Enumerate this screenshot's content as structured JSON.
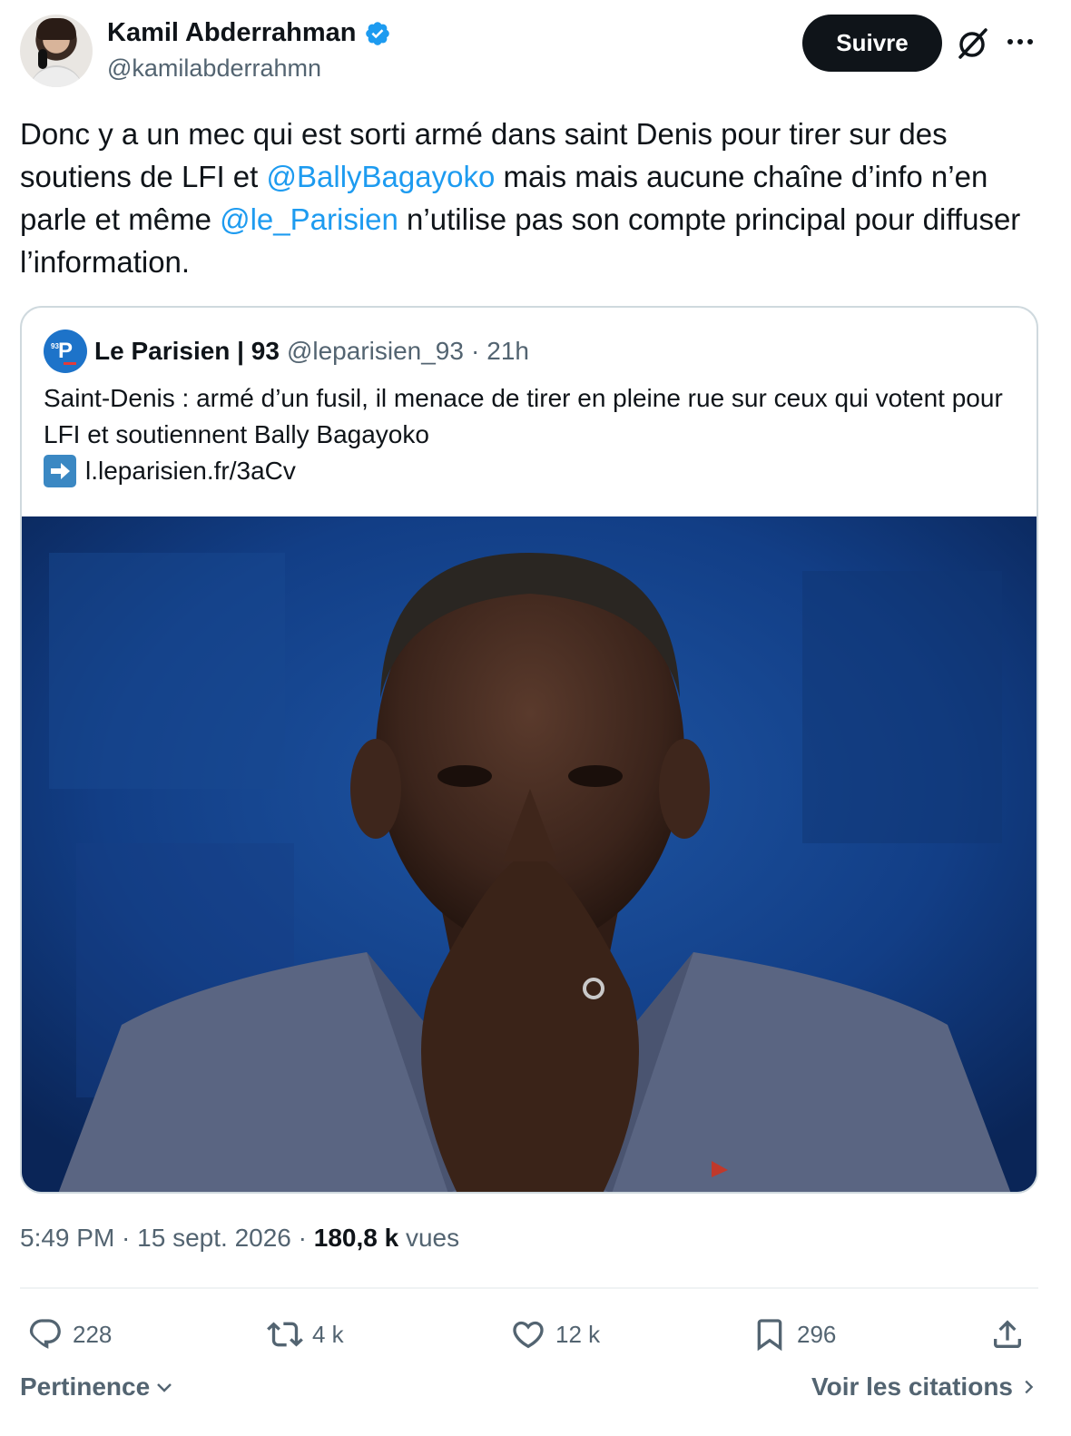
{
  "author": {
    "display_name": "Kamil Abderrahman",
    "handle": "@kamilabderrahmn",
    "verified": true
  },
  "header": {
    "follow_label": "Suivre",
    "more_icon": "more-icon",
    "grok_icon": "grok-icon"
  },
  "tweet": {
    "text_part1": "Donc y a un mec qui est sorti armé dans saint Denis pour tirer sur des soutiens de LFI et ",
    "mention1": "@BallyBagayoko",
    "text_part2": " mais mais aucune chaîne d’info n’en parle et même ",
    "mention2": "@le_Parisien",
    "text_part3": " n’utilise pas son compte principal pour diffuser l’information."
  },
  "quote": {
    "avatar_letter": "P",
    "avatar_small": "93",
    "name": "Le Parisien | 93",
    "handle": "@leparisien_93",
    "separator": "·",
    "time": "21h",
    "text": "Saint-Denis : armé d’un fusil, il menace de tirer en pleine rue sur ceux qui votent pour LFI et soutiennent Bally Bagayoko",
    "link": "l.leparisien.fr/3aCv"
  },
  "stats": {
    "time": "5:49 PM",
    "sep1": " · ",
    "date": "15 sept. 2026",
    "sep2": " · ",
    "views_count": "180,8 k",
    "views_label": " vues"
  },
  "actions": {
    "replies": "228",
    "reposts": "4 k",
    "likes": "12 k",
    "bookmarks": "296"
  },
  "footer": {
    "sort_label": "Pertinence",
    "quotes_label": "Voir les citations"
  },
  "colors": {
    "accent": "#1d9bf0",
    "text": "#0f1419",
    "muted": "#536471",
    "border": "#cfd9de"
  }
}
